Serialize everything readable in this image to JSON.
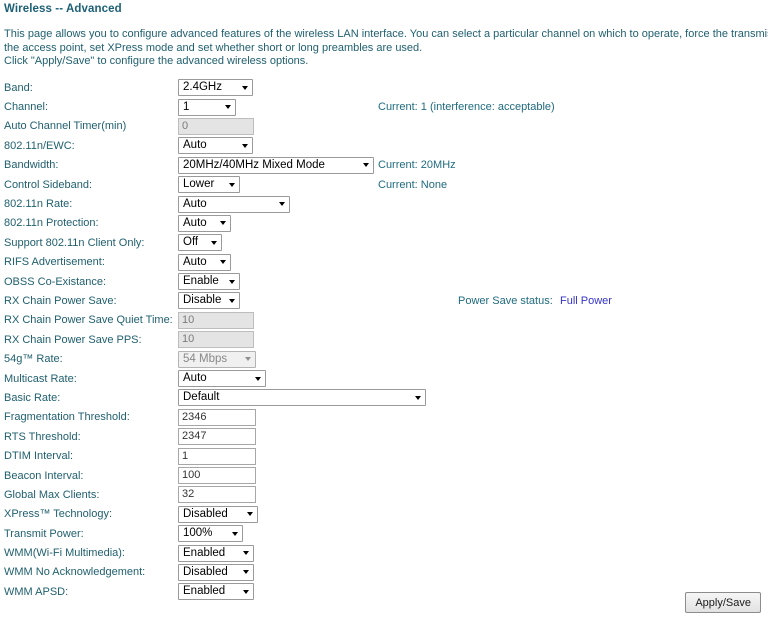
{
  "page": {
    "title": "Wireless -- Advanced",
    "intro_lines": [
      "This page allows you to configure advanced features of the wireless LAN interface. You can select a particular channel on which to operate, force the transmission rate to a part",
      "the access point, set XPress mode and set whether short or long preambles are used.",
      "Click \"Apply/Save\" to configure the advanced wireless options."
    ]
  },
  "notes": {
    "channel": "Current: 1 (interference: acceptable)",
    "bandwidth": "Current: 20MHz",
    "control_sideband": "Current: None",
    "power_save_label": "Power Save status:",
    "power_save_value": "Full Power"
  },
  "fields": {
    "band": {
      "label": "Band:",
      "value": "2.4GHz",
      "type": "select",
      "enabled": true
    },
    "channel": {
      "label": "Channel:",
      "value": "1",
      "type": "select",
      "enabled": true
    },
    "auto_channel_timer": {
      "label": "Auto Channel Timer(min)",
      "value": "0",
      "type": "text",
      "enabled": false
    },
    "n_ewc": {
      "label": "802.11n/EWC:",
      "value": "Auto",
      "type": "select",
      "enabled": true
    },
    "bandwidth": {
      "label": "Bandwidth:",
      "value": "20MHz/40MHz Mixed Mode",
      "type": "select",
      "enabled": true
    },
    "control_sideband": {
      "label": "Control Sideband:",
      "value": "Lower",
      "type": "select",
      "enabled": true
    },
    "n_rate": {
      "label": "802.11n Rate:",
      "value": "Auto",
      "type": "select",
      "enabled": true
    },
    "n_protection": {
      "label": "802.11n Protection:",
      "value": "Auto",
      "type": "select",
      "enabled": true
    },
    "support_n_client_only": {
      "label": "Support 802.11n Client Only:",
      "value": "Off",
      "type": "select",
      "enabled": true
    },
    "rifs_advertisement": {
      "label": "RIFS Advertisement:",
      "value": "Auto",
      "type": "select",
      "enabled": true
    },
    "obss_coexistance": {
      "label": "OBSS Co-Existance:",
      "value": "Enable",
      "type": "select",
      "enabled": true
    },
    "rx_chain_power_save": {
      "label": "RX Chain Power Save:",
      "value": "Disable",
      "type": "select",
      "enabled": true
    },
    "rx_chain_quiet_time": {
      "label": "RX Chain Power Save Quiet Time:",
      "value": "10",
      "type": "text",
      "enabled": false
    },
    "rx_chain_pps": {
      "label": "RX Chain Power Save PPS:",
      "value": "10",
      "type": "text",
      "enabled": false
    },
    "rate_54g": {
      "label": "54g™ Rate:",
      "value": "54 Mbps",
      "type": "select",
      "enabled": false
    },
    "multicast_rate": {
      "label": "Multicast Rate:",
      "value": "Auto",
      "type": "select",
      "enabled": true
    },
    "basic_rate": {
      "label": "Basic Rate:",
      "value": "Default",
      "type": "select",
      "enabled": true
    },
    "fragmentation_threshold": {
      "label": "Fragmentation Threshold:",
      "value": "2346",
      "type": "text",
      "enabled": true
    },
    "rts_threshold": {
      "label": "RTS Threshold:",
      "value": "2347",
      "type": "text",
      "enabled": true
    },
    "dtim_interval": {
      "label": "DTIM Interval:",
      "value": "1",
      "type": "text",
      "enabled": true
    },
    "beacon_interval": {
      "label": "Beacon Interval:",
      "value": "100",
      "type": "text",
      "enabled": true
    },
    "global_max_clients": {
      "label": "Global Max Clients:",
      "value": "32",
      "type": "text",
      "enabled": true
    },
    "xpress_technology": {
      "label": "XPress™ Technology:",
      "value": "Disabled",
      "type": "select",
      "enabled": true
    },
    "transmit_power": {
      "label": "Transmit Power:",
      "value": "100%",
      "type": "select",
      "enabled": true
    },
    "wmm": {
      "label": "WMM(Wi-Fi Multimedia):",
      "value": "Enabled",
      "type": "select",
      "enabled": true
    },
    "wmm_no_ack": {
      "label": "WMM No Acknowledgement:",
      "value": "Disabled",
      "type": "select",
      "enabled": true
    },
    "wmm_apsd": {
      "label": "WMM APSD:",
      "value": "Enabled",
      "type": "select",
      "enabled": true
    }
  },
  "footer": {
    "apply_label": "Apply/Save"
  },
  "colors": {
    "title": "#1c6077",
    "text": "#20606f",
    "link": "#3333cc"
  }
}
